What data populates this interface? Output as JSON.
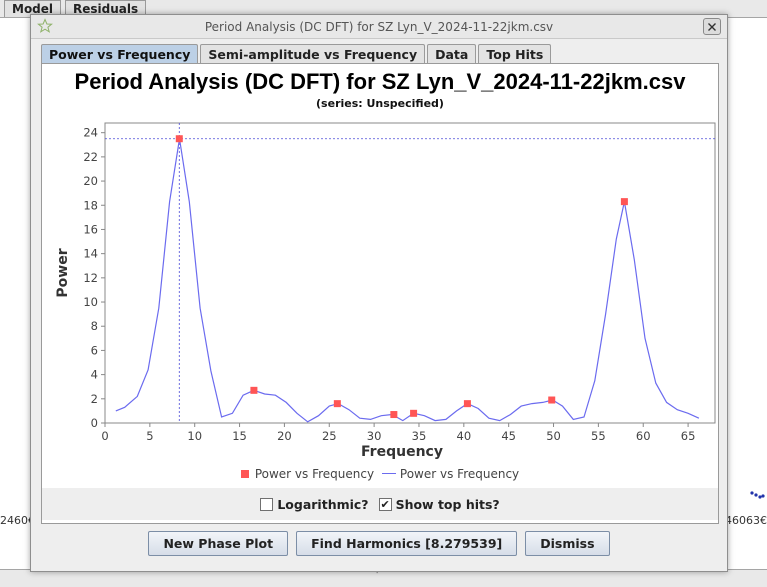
{
  "background": {
    "tabs": [
      {
        "label": "Model"
      },
      {
        "label": "Residuals"
      }
    ],
    "x_left": "2460€",
    "x_right": "46063€"
  },
  "window": {
    "title": "Period Analysis (DC DFT) for SZ Lyn_V_2024-11-22jkm.csv",
    "close_label": "×"
  },
  "tabs": [
    {
      "label": "Power vs Frequency",
      "active": true
    },
    {
      "label": "Semi-amplitude vs Frequency",
      "active": false
    },
    {
      "label": "Data",
      "active": false
    },
    {
      "label": "Top Hits",
      "active": false
    }
  ],
  "colors": {
    "series_line": "#6b6bef",
    "top_hits": "#ff5555",
    "crosshair": "#4a4ad8",
    "active_tab": "#bcd0e6"
  },
  "chart_data": {
    "type": "line",
    "title": "Period Analysis (DC DFT) for SZ Lyn_V_2024-11-22jkm.csv",
    "subtitle": "(series: Unspecified)",
    "xlabel": "Frequency",
    "ylabel": "Power",
    "xlim": [
      0,
      68
    ],
    "ylim": [
      0,
      24.8
    ],
    "xticks": [
      0,
      5,
      10,
      15,
      20,
      25,
      30,
      35,
      40,
      45,
      50,
      55,
      60,
      65
    ],
    "yticks": [
      0,
      2,
      4,
      6,
      8,
      10,
      12,
      14,
      16,
      18,
      20,
      22,
      24
    ],
    "grid": false,
    "legend_position": "bottom",
    "legend": [
      "Power vs Frequency",
      "Power vs Frequency"
    ],
    "crosshair": {
      "x": 8.28,
      "y": 23.5
    },
    "series": [
      {
        "name": "Power vs Frequency",
        "style": "line",
        "x": [
          1.2,
          2.2,
          3.6,
          4.8,
          6.0,
          7.2,
          8.3,
          9.4,
          10.6,
          11.8,
          13.0,
          14.2,
          15.4,
          16.6,
          17.8,
          19.0,
          20.2,
          21.4,
          22.6,
          23.8,
          25.0,
          26.0,
          27.2,
          28.4,
          29.6,
          30.8,
          32.0,
          33.2,
          34.4,
          35.6,
          36.8,
          38.0,
          39.2,
          40.4,
          41.6,
          42.8,
          44.0,
          45.2,
          46.4,
          47.6,
          48.8,
          49.9,
          51.0,
          52.2,
          53.4,
          54.6,
          55.8,
          57.0,
          57.9,
          59.0,
          60.2,
          61.4,
          62.6,
          63.8,
          65.0,
          66.2
        ],
        "y": [
          1.0,
          1.3,
          2.2,
          4.4,
          9.5,
          18.3,
          23.5,
          18.3,
          9.5,
          4.3,
          0.5,
          0.8,
          2.3,
          2.7,
          2.4,
          2.3,
          1.7,
          0.8,
          0.1,
          0.6,
          1.4,
          1.6,
          1.1,
          0.4,
          0.3,
          0.6,
          0.7,
          0.2,
          0.8,
          0.6,
          0.2,
          0.3,
          1.0,
          1.6,
          1.2,
          0.4,
          0.2,
          0.7,
          1.4,
          1.6,
          1.7,
          1.9,
          1.4,
          0.3,
          0.5,
          3.5,
          9.0,
          15.2,
          18.3,
          13.5,
          7.0,
          3.3,
          1.7,
          1.1,
          0.8,
          0.4
        ]
      },
      {
        "name": "Power vs Frequency",
        "style": "markers",
        "x": [
          8.28,
          16.6,
          25.9,
          32.2,
          34.4,
          40.4,
          49.8,
          57.9
        ],
        "y": [
          23.5,
          2.7,
          1.6,
          0.7,
          0.8,
          1.6,
          1.9,
          18.3
        ]
      }
    ]
  },
  "options": {
    "logarithmic_label": "Logarithmic?",
    "logarithmic_checked": false,
    "show_top_hits_label": "Show top hits?",
    "show_top_hits_checked": true,
    "check_mark": "✔"
  },
  "buttons": {
    "new_phase_plot": "New Phase Plot",
    "find_harmonics": "Find Harmonics [8.279539]",
    "dismiss": "Dismiss"
  }
}
